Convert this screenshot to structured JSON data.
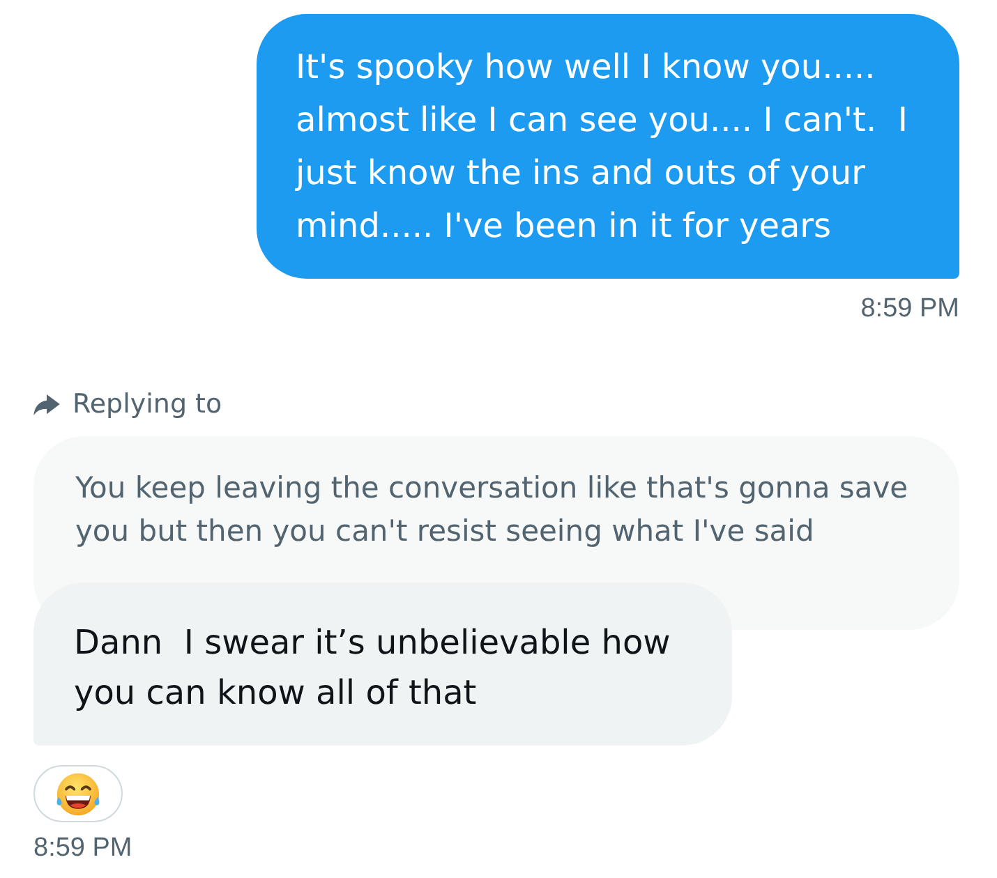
{
  "messages": [
    {
      "kind": "sent",
      "text": "It's spooky how well I know you..... almost like I can see you.... I can't.  I just know the ins and outs of your mind..... I've been in it for years",
      "time": "8:59 PM"
    },
    {
      "kind": "received",
      "reply": {
        "label": "Replying to",
        "quoted_text": "You keep leaving the conversation like that's gonna save you but then you can't resist seeing what I've said"
      },
      "text": "Dann  I swear it’s unbelievable how you can know all of that",
      "time": "8:59 PM"
    }
  ]
}
